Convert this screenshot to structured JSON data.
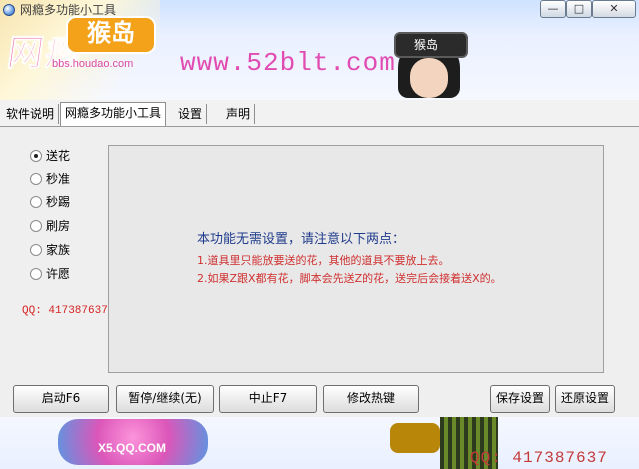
{
  "window": {
    "title": "网瘾多功能小工具",
    "controls": {
      "minimize": "—",
      "maximize": "□",
      "close": "✕"
    }
  },
  "banner": {
    "logo_text": "网瘾",
    "logo_badge": "猴岛",
    "logo_sub": "bbs.houdao.com",
    "site_url": "www.52blt.com",
    "character_hat": "猴岛"
  },
  "tabs": [
    {
      "label": "软件说明",
      "active": false
    },
    {
      "label": "网瘾多功能小工具",
      "active": true
    },
    {
      "label": "设置",
      "active": false
    },
    {
      "label": "声明",
      "active": false
    }
  ],
  "radios": [
    {
      "label": "送花",
      "checked": true
    },
    {
      "label": "秒准",
      "checked": false
    },
    {
      "label": "秒踢",
      "checked": false
    },
    {
      "label": "刷房",
      "checked": false
    },
    {
      "label": "家族",
      "checked": false
    },
    {
      "label": "许愿",
      "checked": false
    }
  ],
  "qq_left": "QQ: 417387637",
  "info": {
    "title": "本功能无需设置，请注意以下两点：",
    "line1": "1.道具里只能放要送的花，其他的道具不要放上去。",
    "line2": "2.如果Z跟X都有花，脚本会先送Z的花，送完后会接着送X的。"
  },
  "buttons": {
    "start": "启动F6",
    "pause": "暂停/继续(无)",
    "stop": "中止F7",
    "hotkey": "修改热键",
    "save": "保存设置",
    "restore": "还原设置"
  },
  "footer": {
    "x5_logo": "X5.QQ.COM",
    "qq_text": "QQ: 417387637"
  },
  "colors": {
    "accent_pink": "#e04cb1",
    "info_title": "#1f3b8c",
    "info_text": "#d03030",
    "qq_red": "#d62222"
  }
}
